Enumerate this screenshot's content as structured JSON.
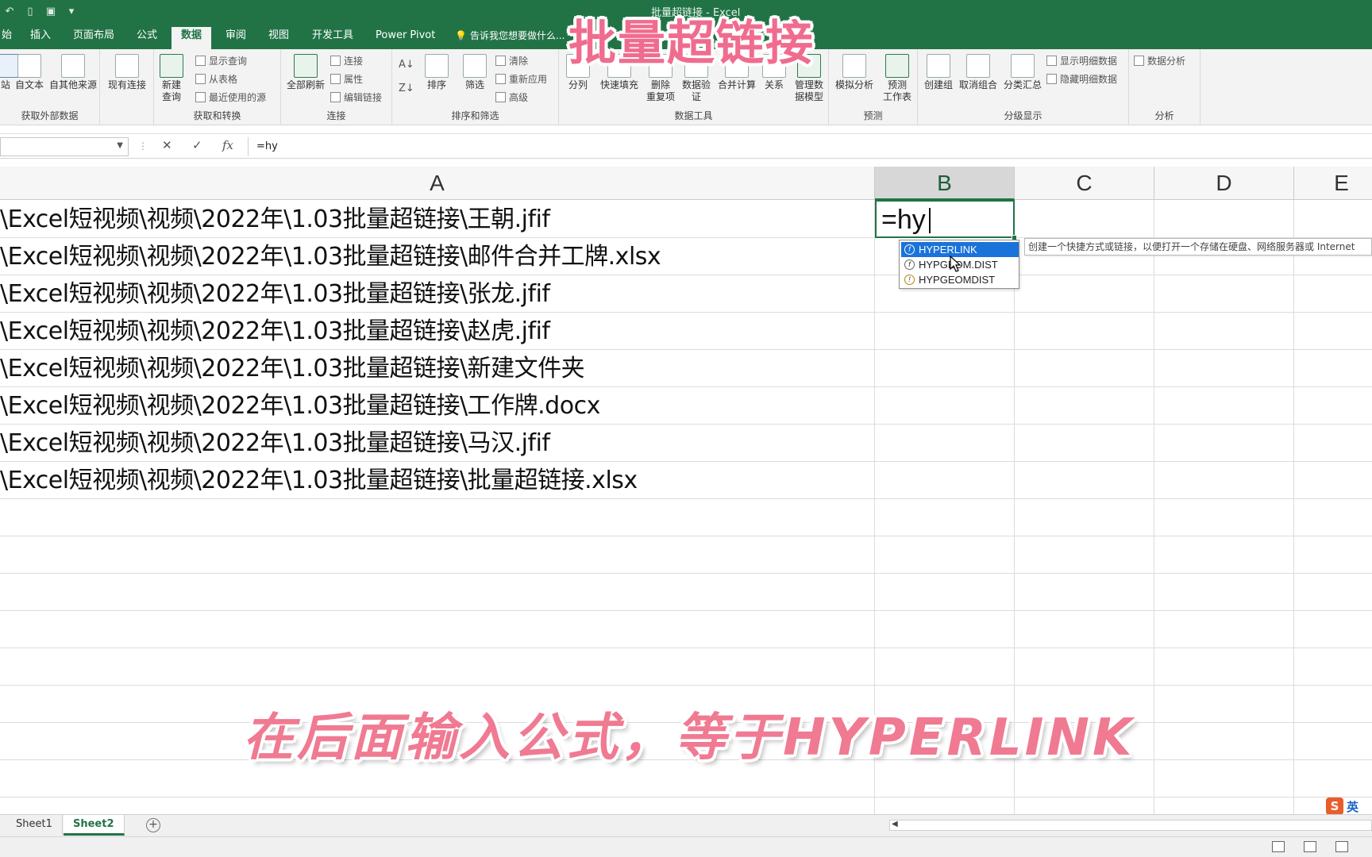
{
  "window": {
    "title": "批量超链接 - Excel"
  },
  "tabs": [
    "插入",
    "页面布局",
    "公式",
    "数据",
    "审阅",
    "视图",
    "开发工具",
    "Power Pivot"
  ],
  "active_tab": "数据",
  "tell_me": "告诉我您想要做什么...",
  "ribbon": {
    "external": {
      "label": "获取外部数据",
      "btn_web": "站",
      "btn_text": "自文本",
      "btn_other": "自其他来源",
      "btn_existing": "现有连接"
    },
    "transform": {
      "label": "获取和转换",
      "new_query": "新建\n查询",
      "show_query": "显示查询",
      "from_table": "从表格",
      "recent": "最近使用的源"
    },
    "connections": {
      "label": "连接",
      "refresh_all": "全部刷新",
      "connections": "连接",
      "properties": "属性",
      "edit_links": "编辑链接"
    },
    "sort": {
      "label": "排序和筛选",
      "sort": "排序",
      "filter": "筛选",
      "clear": "清除",
      "reapply": "重新应用",
      "advanced": "高级"
    },
    "tools": {
      "label": "数据工具",
      "split": "分列",
      "flash_fill": "快速填充",
      "remove_dup": "删除\n重复项",
      "validation": "数据验\n证",
      "consolidate": "合并计算",
      "relations": "关系",
      "manage_model": "管理数\n据模型"
    },
    "forecast": {
      "label": "预测",
      "whatif": "模拟分析",
      "sheet": "预测\n工作表"
    },
    "outline": {
      "label": "分级显示",
      "group": "创建组",
      "ungroup": "取消组合",
      "subtotal": "分类汇总",
      "show_detail": "显示明细数据",
      "hide_detail": "隐藏明细数据"
    },
    "analysis": {
      "label": "分析",
      "data_analysis": "数据分析"
    }
  },
  "formula_bar": {
    "name_box": "",
    "content": "=hy",
    "cancel": "✕",
    "enter": "✓",
    "fx": "fx"
  },
  "columns": [
    "A",
    "B",
    "C",
    "D",
    "E"
  ],
  "cells_a": [
    "\\Excel短视频\\视频\\2022年\\1.03批量超链接\\王朝.jfif",
    "\\Excel短视频\\视频\\2022年\\1.03批量超链接\\邮件合并工牌.xlsx",
    "\\Excel短视频\\视频\\2022年\\1.03批量超链接\\张龙.jfif",
    "\\Excel短视频\\视频\\2022年\\1.03批量超链接\\赵虎.jfif",
    "\\Excel短视频\\视频\\2022年\\1.03批量超链接\\新建文件夹",
    "\\Excel短视频\\视频\\2022年\\1.03批量超链接\\工作牌.docx",
    "\\Excel短视频\\视频\\2022年\\1.03批量超链接\\马汉.jfif",
    "\\Excel短视频\\视频\\2022年\\1.03批量超链接\\批量超链接.xlsx"
  ],
  "active_cell": {
    "value": "=hy"
  },
  "autocomplete": [
    "HYPERLINK",
    "HYPGEOM.DIST",
    "HYPGEOMDIST"
  ],
  "tooltip": "创建一个快捷方式或链接，以便打开一个存储在硬盘、网络服务器或 Internet",
  "captions": {
    "title": "批量超链接",
    "subtitle": "在后面输入公式，等于HYPERLINK"
  },
  "sheets": [
    "Sheet1",
    "Sheet2"
  ],
  "active_sheet": "Sheet2",
  "ime": {
    "logo": "S",
    "mode": "英"
  },
  "colors": {
    "excel_green": "#217346",
    "caption_pink": "#f06c8e",
    "selection_blue": "#1a73d9"
  }
}
